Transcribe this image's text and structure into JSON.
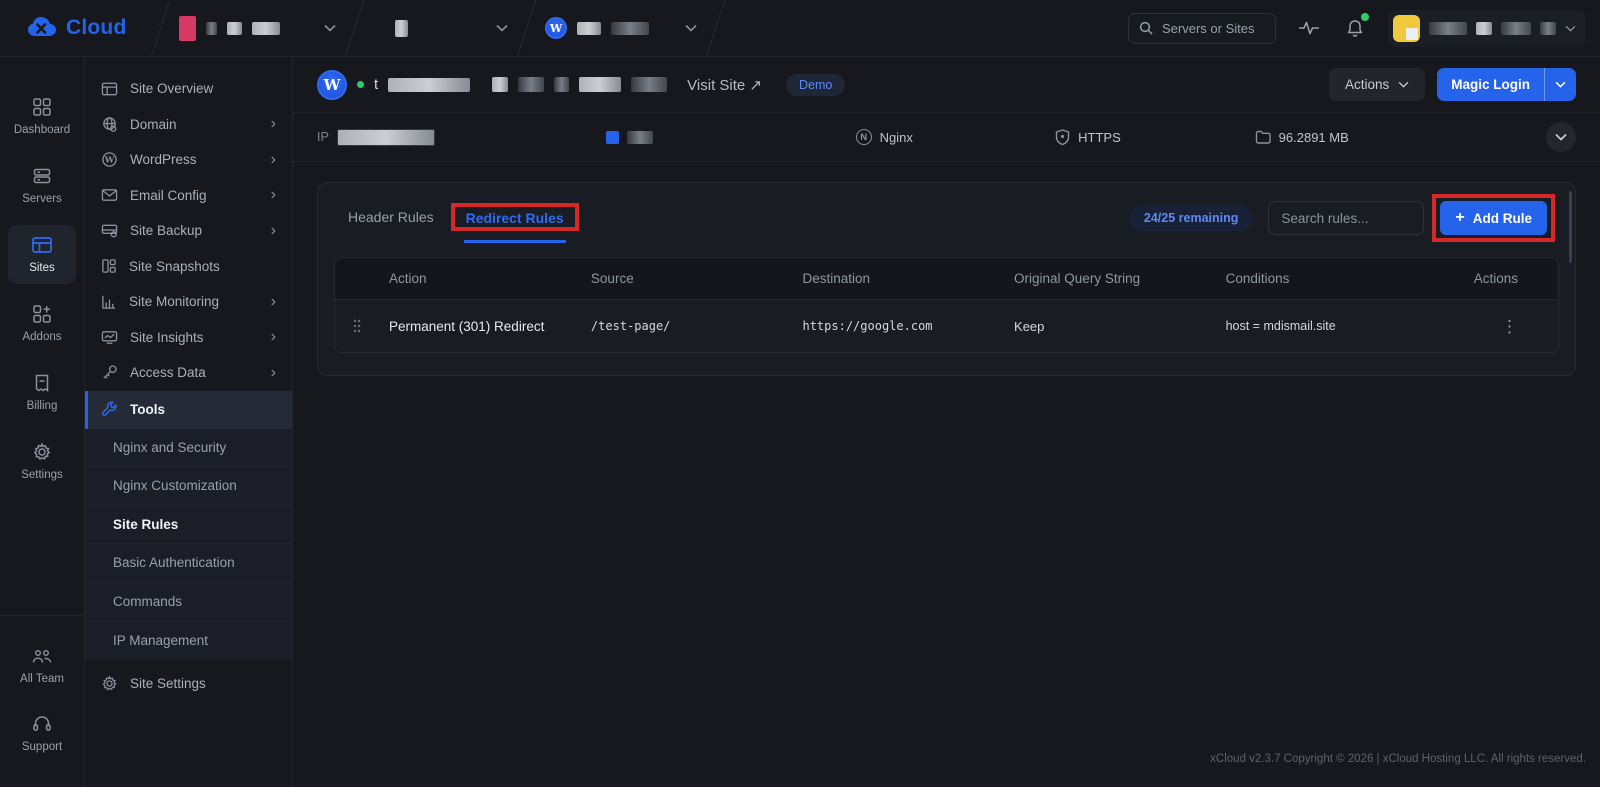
{
  "brand": {
    "word": "Cloud"
  },
  "topbar": {
    "search_placeholder": "Servers or Sites"
  },
  "rail": {
    "items": [
      {
        "label": "Dashboard"
      },
      {
        "label": "Servers"
      },
      {
        "label": "Sites"
      },
      {
        "label": "Addons"
      },
      {
        "label": "Billing"
      },
      {
        "label": "Settings"
      }
    ],
    "bottom_items": [
      {
        "label": "All Team"
      },
      {
        "label": "Support"
      }
    ]
  },
  "sidebar": {
    "items": [
      {
        "label": "Site Overview"
      },
      {
        "label": "Domain"
      },
      {
        "label": "WordPress"
      },
      {
        "label": "Email Config"
      },
      {
        "label": "Site Backup"
      },
      {
        "label": "Site Snapshots"
      },
      {
        "label": "Site Monitoring"
      },
      {
        "label": "Site Insights"
      },
      {
        "label": "Access Data"
      },
      {
        "label": "Tools"
      },
      {
        "label": "Site Settings"
      }
    ],
    "tools_submenu": [
      {
        "label": "Nginx and Security"
      },
      {
        "label": "Nginx Customization"
      },
      {
        "label": "Site Rules"
      },
      {
        "label": "Basic Authentication"
      },
      {
        "label": "Commands"
      },
      {
        "label": "IP Management"
      }
    ]
  },
  "site_header": {
    "name_prefix": "t",
    "visit_site_label": "Visit Site ↗",
    "demo_badge": "Demo",
    "actions_label": "Actions",
    "magic_login_label": "Magic Login"
  },
  "info_bar": {
    "ip_label": "IP",
    "web_server": "Nginx",
    "web_server_initial": "N",
    "ssl": "HTTPS",
    "disk_usage": "96.2891 MB"
  },
  "rules_panel": {
    "tabs": [
      {
        "label": "Header Rules"
      },
      {
        "label": "Redirect Rules"
      }
    ],
    "active_tab": "Redirect Rules",
    "remaining_badge": "24/25 remaining",
    "search_placeholder": "Search rules...",
    "add_rule_label": "Add Rule",
    "add_rule_plus": "+",
    "table": {
      "headers": [
        "Action",
        "Source",
        "Destination",
        "Original Query String",
        "Conditions",
        "Actions"
      ],
      "rows": [
        {
          "action": "Permanent (301) Redirect",
          "source": "/test-page/",
          "destination": "https://google.com",
          "query_string": "Keep",
          "conditions": "host = mdismail.site"
        }
      ]
    }
  },
  "footer": {
    "text": "xCloud v2.3.7 Copyright © 2026 | xCloud Hosting LLC. All rights reserved."
  },
  "colors": {
    "accent": "#2563eb",
    "annotation_red": "#d62828",
    "badge_blue": "#5c8bf5",
    "avatar_yellow": "#f0c93c",
    "status_green": "#2ecc71",
    "pink_block": "#d63964"
  }
}
